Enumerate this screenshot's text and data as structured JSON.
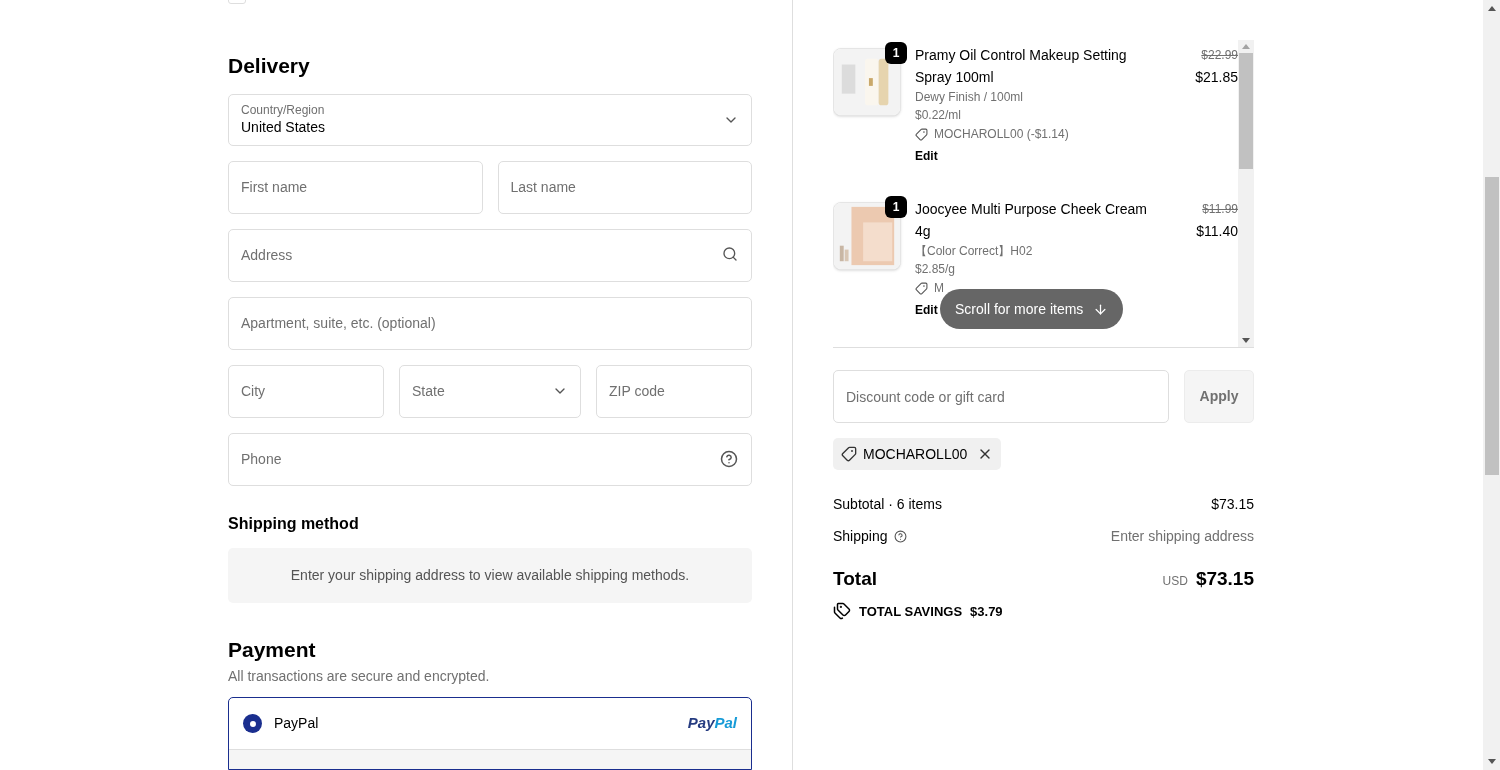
{
  "top_checkbox": {
    "checked": false
  },
  "delivery": {
    "title": "Delivery",
    "country": {
      "label": "Country/Region",
      "value": "United States"
    },
    "fields": [
      {
        "placeholder": "First name"
      },
      {
        "placeholder": "Last name"
      }
    ],
    "address": {
      "placeholder": "Address"
    },
    "apartment": {
      "placeholder": "Apartment, suite, etc. (optional)"
    },
    "city": {
      "placeholder": "City"
    },
    "state": {
      "placeholder": "State"
    },
    "zip": {
      "placeholder": "ZIP code"
    },
    "phone": {
      "placeholder": "Phone"
    }
  },
  "shipping_method": {
    "title": "Shipping method",
    "message": "Enter your shipping address to view available shipping methods."
  },
  "payment": {
    "title": "Payment",
    "subtitle": "All transactions are secure and encrypted.",
    "options": [
      {
        "label": "PayPal",
        "logo_a": "Pay",
        "logo_b": "Pal",
        "selected": true
      }
    ]
  },
  "cart": {
    "items": [
      {
        "quantity": "1",
        "name": "Pramy Oil Control Makeup Setting Spray 100ml",
        "variant": "Dewy Finish / 100ml",
        "unit_price": "$0.22/ml",
        "discount": "MOCHAROLL00 (-$1.14)",
        "edit": "Edit",
        "original_price": "$22.99",
        "price": "$21.85"
      },
      {
        "quantity": "1",
        "name": "Joocyee Multi Purpose Cheek Cream 4g",
        "variant": "【Color Correct】H02",
        "unit_price": "$2.85/g",
        "discount": "M",
        "edit": "Edit",
        "original_price": "$11.99",
        "price": "$11.40"
      }
    ],
    "scroll_hint": "Scroll for more items"
  },
  "discount": {
    "placeholder": "Discount code or gift card",
    "apply": "Apply",
    "applied_code": "MOCHAROLL00"
  },
  "summary": {
    "subtotal_label": "Subtotal · 6 items",
    "subtotal": "$73.15",
    "shipping_label": "Shipping",
    "shipping": "Enter shipping address",
    "total_label": "Total",
    "currency": "USD",
    "total": "$73.15",
    "savings_label": "TOTAL SAVINGS",
    "savings": "$3.79"
  }
}
